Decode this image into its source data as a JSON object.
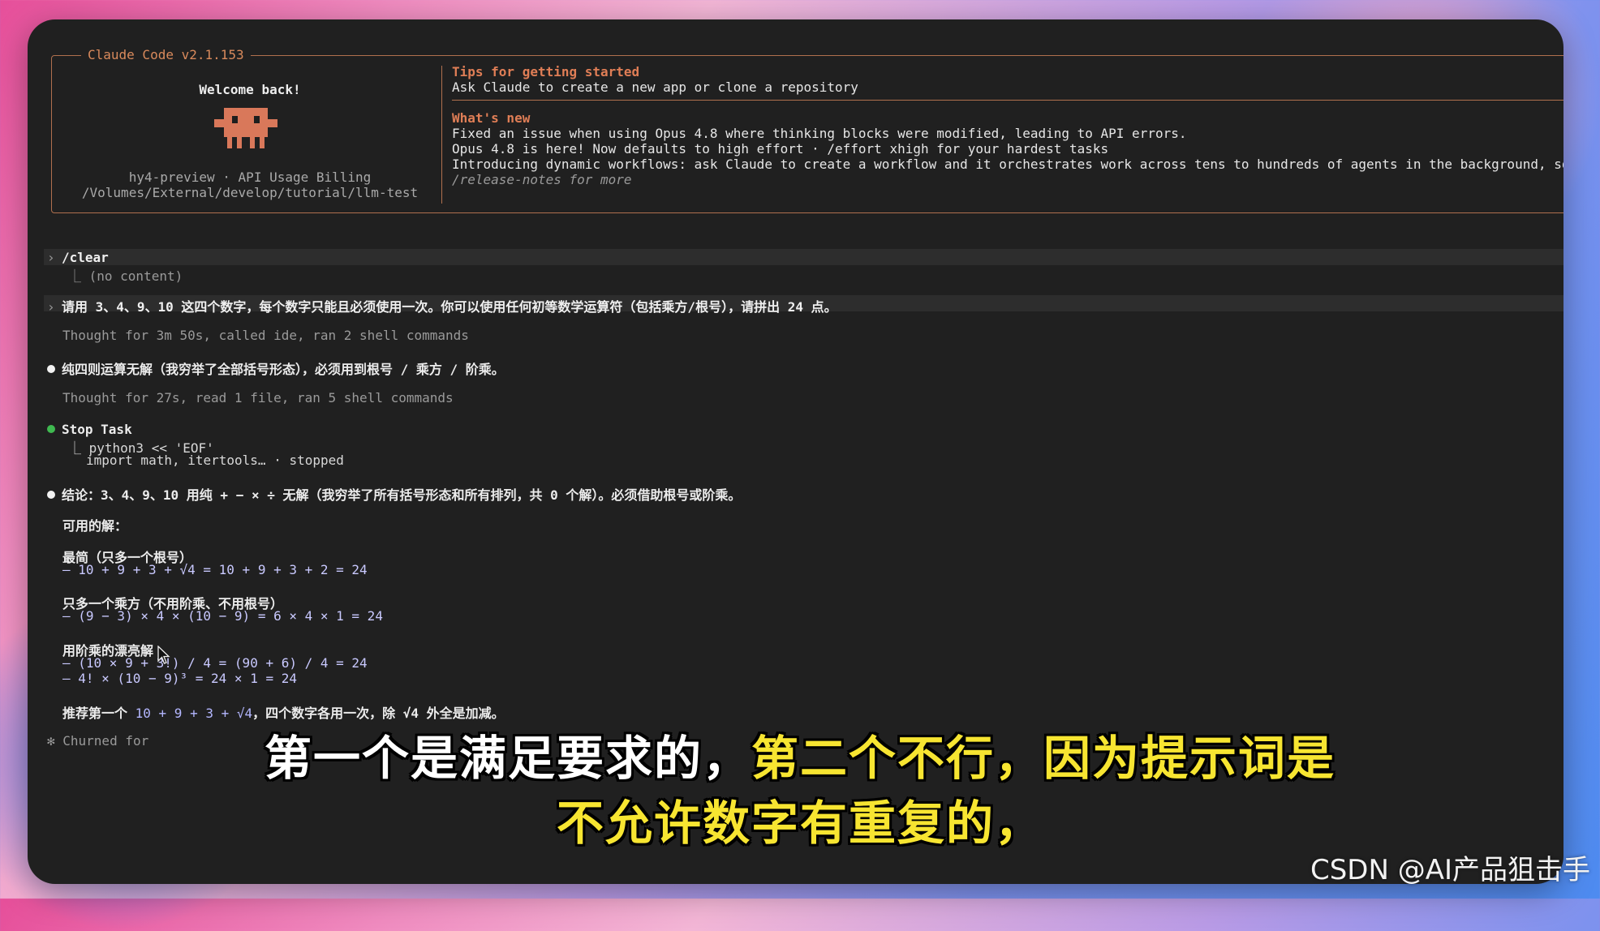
{
  "header": {
    "title": "Claude Code v2.1.153",
    "welcome": "Welcome back!",
    "account": "hy4-preview · API Usage Billing",
    "path": "/Volumes/External/develop/tutorial/llm-test",
    "tips_title": "Tips for getting started",
    "tips_line": "Ask Claude to create a new app or clone a repository",
    "whats_new_title": "What's new",
    "whats_new": [
      "Fixed an issue when using Opus 4.8 where thinking blocks were modified, leading to API errors.",
      "Opus 4.8 is here! Now defaults to high effort · /effort xhigh for your hardest tasks",
      "Introducing dynamic workflows: ask Claude to create a workflow and it orchestrates work across tens to hundreds of agents in the background, so"
    ],
    "release_notes": "/release-notes for more",
    "accent_color": "#d98a5c"
  },
  "transcript": {
    "clear_prompt_symbol": "›",
    "clear_cmd": "/clear",
    "clear_result": "⎿  (no content)",
    "user_prompt_symbol": "›",
    "user_prompt": "请用 3、4、9、10 这四个数字，每个数字只能且必须使用一次。你可以使用任何初等数学运算符（包括乘方/根号），请拼出 24 点。",
    "thought1": "Thought for 3m 50s, called ide, ran 2 shell commands",
    "msg1": "纯四则运算无解（我穷举了全部括号形态），必须用到根号 / 乘方 / 阶乘。",
    "thought2": "Thought for 27s, read 1 file, ran 5 shell commands",
    "stop_task": "Stop Task",
    "stop_line1": "⎿  python3 << 'EOF'",
    "stop_line2": "import math, itertools… · stopped",
    "conclusion": "结论：3、4、9、10 用纯 + − × ÷ 无解（我穷举了所有括号形态和所有排列，共 0 个解）。必须借助根号或阶乘。",
    "usable": "可用的解：",
    "sol1_title": "最简（只多一个根号）",
    "sol1_line": "– 10 + 9 + 3 + √4 = 10 + 9 + 3 + 2 = 24",
    "sol2_title": "只多一个乘方（不用阶乘、不用根号）",
    "sol2_line": "– (9 − 3) × 4 × (10 − 9) = 6 × 4 × 1 = 24",
    "sol3_title": "用阶乘的漂亮解",
    "sol3_line1": "– (10 × 9 + 3!) / 4 = (90 + 6) / 4 = 24",
    "sol3_line2": "– 4! × (10 − 9)³ = 24 × 1 = 24",
    "recommend_prefix": "推荐第一个 ",
    "recommend_formula": "10 + 9 + 3 + √4",
    "recommend_suffix": "，四个数字各用一次，除 √4 外全是加减。",
    "churned": "✻ Churned for"
  },
  "subtitle": {
    "line1_white": "第一个是满足要求的，",
    "line1_yellow": "第二个不行，因为提示词是",
    "line2": "不允许数字有重复的，"
  },
  "watermark": "CSDN @AI产品狙击手"
}
